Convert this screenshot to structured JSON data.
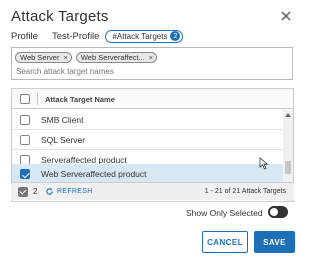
{
  "dialog": {
    "title": "Attack Targets",
    "close_icon": "close-icon"
  },
  "breadcrumb": {
    "profile": "Profile",
    "test_profile": "Test-Profile",
    "chip_label": "#Attack Targets",
    "chip_count": "2"
  },
  "filter": {
    "tags": [
      {
        "label": "Web Server"
      },
      {
        "label": "Web Serveraffect..."
      }
    ],
    "tag_remove": "×",
    "placeholder": "Search attack target names"
  },
  "grid": {
    "column_header": "Attack Target Name",
    "rows": [
      {
        "name": "SMB Client",
        "checked": false
      },
      {
        "name": "SQL Server",
        "checked": false
      },
      {
        "name": "Serveraffected product",
        "checked": false
      },
      {
        "name": "Web Serveraffected product",
        "checked": true
      }
    ]
  },
  "footer": {
    "selected_count": "2",
    "refresh_label": "REFRESH",
    "range_text": "1 - 21 of 21 Attack Targets"
  },
  "show_only_selected": {
    "label": "Show Only Selected",
    "on": false
  },
  "buttons": {
    "cancel": "CANCEL",
    "save": "SAVE"
  },
  "colors": {
    "accent": "#1d6fb8",
    "selected_row": "#d6e8f3"
  }
}
